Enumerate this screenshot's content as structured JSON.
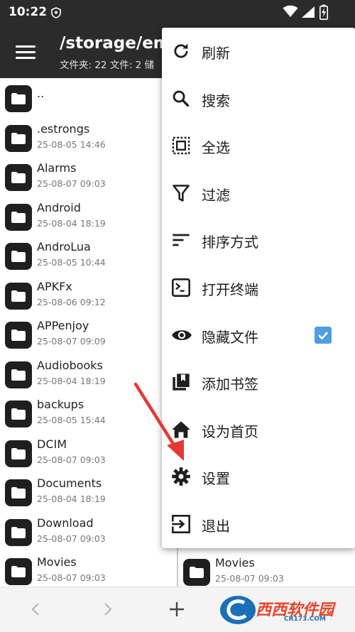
{
  "status_bar": {
    "time": "10:22",
    "icons": [
      "shield-icon",
      "wifi-icon",
      "signal-icon",
      "battery-charging-icon"
    ]
  },
  "app_bar": {
    "path": "/storage/emu",
    "stats": "文件夹: 22  文件: 2  储"
  },
  "files": [
    {
      "name": "..",
      "date": ""
    },
    {
      "name": ".estrongs",
      "date": "25-08-05 14:46"
    },
    {
      "name": "Alarms",
      "date": "25-08-07 09:03"
    },
    {
      "name": "Android",
      "date": "25-08-04 18:19"
    },
    {
      "name": "AndroLua",
      "date": "25-08-05 10:44"
    },
    {
      "name": "APKFx",
      "date": "25-08-06 09:12"
    },
    {
      "name": "APPenjoy",
      "date": "25-08-07 09:09"
    },
    {
      "name": "Audiobooks",
      "date": "25-08-04 18:19"
    },
    {
      "name": "backups",
      "date": "25-08-05 15:44"
    },
    {
      "name": "DCIM",
      "date": "25-08-07 09:03"
    },
    {
      "name": "Documents",
      "date": "25-08-04 18:19"
    },
    {
      "name": "Download",
      "date": "25-08-07 09:03"
    },
    {
      "name": "Movies",
      "date": "25-08-07 09:03"
    }
  ],
  "right_pane_files": [
    {
      "name": "Movies",
      "date": "25-08-07 09:03"
    }
  ],
  "menu": {
    "items": [
      {
        "label": "刷新",
        "icon": "refresh-icon"
      },
      {
        "label": "搜索",
        "icon": "search-icon"
      },
      {
        "label": "全选",
        "icon": "select-all-icon"
      },
      {
        "label": "过滤",
        "icon": "filter-icon"
      },
      {
        "label": "排序方式",
        "icon": "sort-icon"
      },
      {
        "label": "打开终端",
        "icon": "terminal-icon"
      },
      {
        "label": "隐藏文件",
        "icon": "eye-icon",
        "checked": true
      },
      {
        "label": "添加书签",
        "icon": "bookmark-icon"
      },
      {
        "label": "设为首页",
        "icon": "home-icon"
      },
      {
        "label": "设置",
        "icon": "gear-icon"
      },
      {
        "label": "退出",
        "icon": "exit-icon"
      }
    ]
  },
  "bottom_bar": {
    "icons": [
      "back-arrow-icon",
      "forward-arrow-icon",
      "add-icon"
    ],
    "watermark_text": "西西软件园",
    "watermark_url": "CR173.COM"
  },
  "colors": {
    "app_bar": "#2b2b2b",
    "checkbox": "#4f9ee3",
    "arrow": "#e53935"
  }
}
